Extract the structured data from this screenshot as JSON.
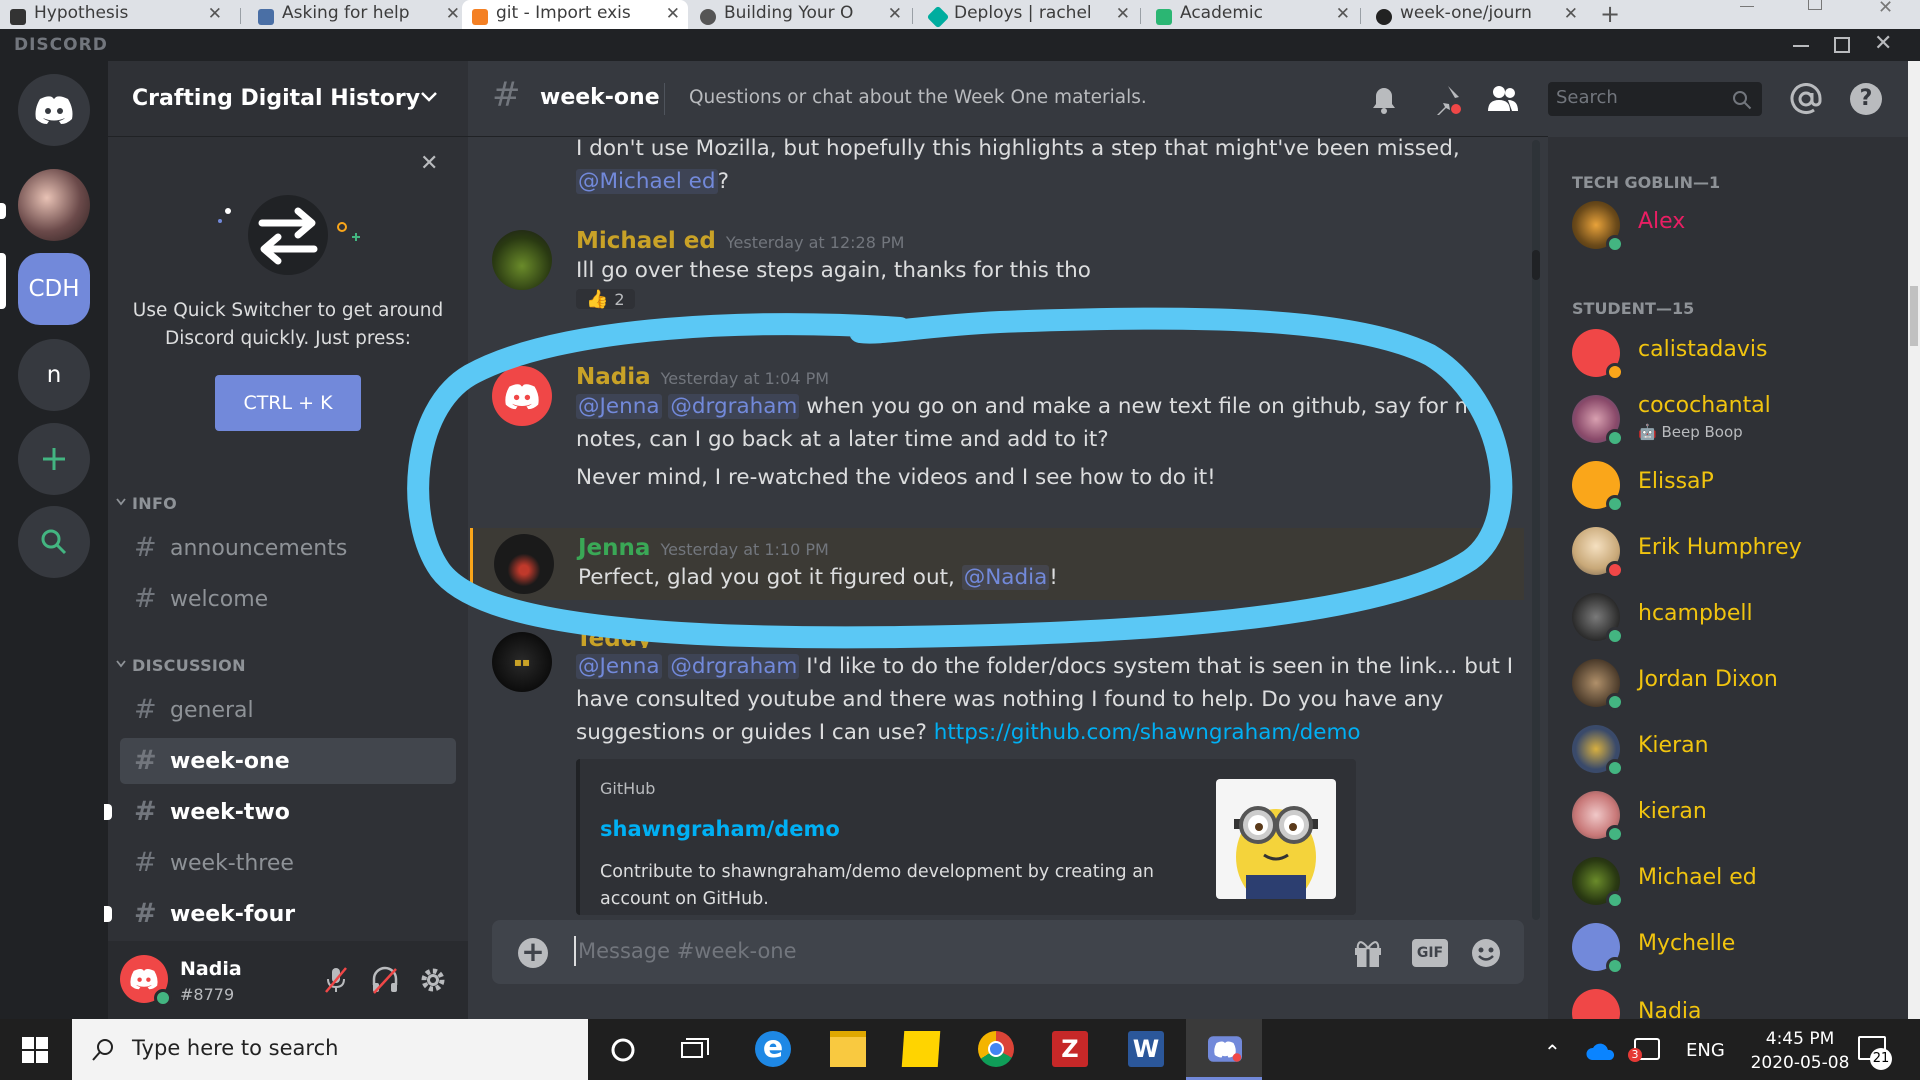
{
  "browser": {
    "tabs": [
      {
        "label": "Hypothesis",
        "favicon_color": "#333333"
      },
      {
        "label": "Asking for help",
        "favicon_color": "#4a6fa5"
      },
      {
        "label": "git - Import exis",
        "favicon_color": "#f48024"
      },
      {
        "label": "Building Your O",
        "favicon_color": "#555555"
      },
      {
        "label": "Deploys | rachel",
        "favicon_color": "#00ad9f"
      },
      {
        "label": "Academic",
        "favicon_color": "#2bb673"
      },
      {
        "label": "week-one/journ",
        "favicon_color": "#222222"
      }
    ],
    "new_tab": "+"
  },
  "app": {
    "brand": "DISCORD"
  },
  "servers": [
    {
      "label": "CDH",
      "color": "#7289da"
    },
    {
      "label": "n",
      "color": "#36393f"
    }
  ],
  "guild": {
    "name": "Crafting Digital History"
  },
  "quick_switcher": {
    "text_line1": "Use Quick Switcher to get around",
    "text_line2": "Discord quickly. Just press:",
    "shortcut": "CTRL + K"
  },
  "categories": [
    {
      "name": "INFO",
      "channels": [
        {
          "name": "announcements",
          "state": "normal"
        },
        {
          "name": "welcome",
          "state": "normal"
        }
      ]
    },
    {
      "name": "DISCUSSION",
      "channels": [
        {
          "name": "general",
          "state": "normal"
        },
        {
          "name": "week-one",
          "state": "selected"
        },
        {
          "name": "week-two",
          "state": "unread"
        },
        {
          "name": "week-three",
          "state": "normal"
        },
        {
          "name": "week-four",
          "state": "unread"
        }
      ]
    }
  ],
  "user": {
    "name": "Nadia",
    "tag": "#8779"
  },
  "channel_header": {
    "name": "week-one",
    "topic": "Questions or chat about the Week One materials.",
    "search_placeholder": "Search"
  },
  "messages": [
    {
      "continuation": true,
      "text": "I don't use Mozilla, but hopefully this highlights a step that might've been missed,",
      "mention": "@Michael ed",
      "after": "?"
    },
    {
      "author": "Michael ed",
      "timestamp": "Yesterday at 12:28 PM",
      "text": "Ill go over these steps again, thanks for this tho",
      "reaction": {
        "emoji": "👍",
        "count": "2"
      }
    },
    {
      "author": "Nadia",
      "timestamp": "Yesterday at 1:04 PM",
      "mentions": [
        "@Jenna",
        "@drgraham"
      ],
      "text1": " when you go on and make a new text file on github, say for my",
      "text2": "notes, can I go back at a later time and add to it?",
      "text3": "Never mind, I re-watched the videos and I see how to do it!"
    },
    {
      "author": "Jenna",
      "timestamp": "Yesterday at 1:10 PM",
      "text": "Perfect, glad you got it figured out, ",
      "mention": "@Nadia",
      "after": "!"
    },
    {
      "author": "Teddy",
      "mentions": [
        "@Jenna",
        "@drgraham"
      ],
      "text1": " I'd like to do the folder/docs system that is seen in the link... but I",
      "text2": "have consulted youtube and there was nothing I found to help. Do you have any",
      "text3": "suggestions or guides I can use? ",
      "link": "https://github.com/shawngraham/demo",
      "embed": {
        "provider": "GitHub",
        "title": "shawngraham/demo",
        "desc1": "Contribute to shawngraham/demo development by creating an",
        "desc2": "account on GitHub."
      }
    }
  ],
  "composer": {
    "placeholder": "Message #week-one"
  },
  "member_groups": [
    {
      "label": "TECH GOBLIN—1",
      "members": [
        {
          "name": "Alex",
          "color": "#e91e63",
          "status": "online"
        }
      ]
    },
    {
      "label": "STUDENT—15",
      "members": [
        {
          "name": "calistadavis",
          "color": "#f1c40f",
          "status": "idle"
        },
        {
          "name": "cocochantal",
          "color": "#f1c40f",
          "status": "online",
          "activity": "Beep Boop"
        },
        {
          "name": "ElissaP",
          "color": "#f1c40f",
          "status": "online"
        },
        {
          "name": "Erik Humphrey",
          "color": "#f1c40f",
          "status": "dnd"
        },
        {
          "name": "hcampbell",
          "color": "#f1c40f",
          "status": "online"
        },
        {
          "name": "Jordan Dixon",
          "color": "#f1c40f",
          "status": "online"
        },
        {
          "name": "Kieran",
          "color": "#f1c40f",
          "status": "online"
        },
        {
          "name": "kieran",
          "color": "#f1c40f",
          "status": "online"
        },
        {
          "name": "Michael ed",
          "color": "#f1c40f",
          "status": "online"
        },
        {
          "name": "Mychelle",
          "color": "#f1c40f",
          "status": "online"
        },
        {
          "name": "Nadia",
          "color": "#f1c40f",
          "status": "online"
        }
      ]
    }
  ],
  "taskbar": {
    "search_placeholder": "Type here to search",
    "language": "ENG",
    "time": "4:45 PM",
    "date": "2020-05-08",
    "notification_count": "21",
    "battery_badge": "3"
  },
  "colors": {
    "accent": "#7289da",
    "annotation": "#5bc8f5",
    "role_gold": "#f1c40f",
    "role_pink": "#e91e63"
  }
}
